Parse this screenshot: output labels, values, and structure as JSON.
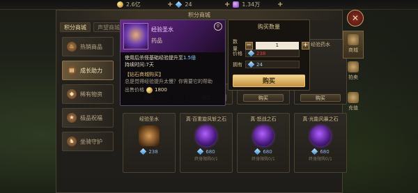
{
  "topbar": {
    "gold": "2.6亿",
    "diamonds": "24",
    "gems": "1.34万"
  },
  "panel": {
    "title": "积分商城",
    "tabs": [
      {
        "label": "积分商城",
        "active": true
      },
      {
        "label": "声望商城",
        "active": false
      }
    ]
  },
  "side_menu": [
    {
      "label": "热销商品",
      "icon": "fire-icon",
      "active": false
    },
    {
      "label": "成长助力",
      "icon": "book-icon",
      "active": true
    },
    {
      "label": "稀有物资",
      "icon": "gem-icon",
      "active": false
    },
    {
      "label": "极品祝福",
      "icon": "star-icon",
      "active": false
    },
    {
      "label": "坐骑守护",
      "icon": "mount-icon",
      "active": false
    }
  ],
  "tooltip": {
    "name": "经验圣水",
    "type": "药品",
    "effect_prefix": "使用后杀怪基础经验提升至",
    "effect_value": "1.5倍",
    "duration_prefix": "持续时间:",
    "duration_value": "7天",
    "section": "【钻石商城购买】",
    "desc": "总是觉得经验提升太慢？你需要它的帮助",
    "sell_label": "出售价格",
    "sell_price": "1800"
  },
  "buy": {
    "title": "购买数量",
    "qty_label": "数量",
    "qty_value": "1",
    "price_label": "价格",
    "price_value": "238",
    "owned_label": "拥有",
    "owned_value": "24",
    "buy_label": "购买"
  },
  "cards_top": [
    {
      "name": "",
      "buy": "购买"
    },
    {
      "name": "",
      "buy": "购买"
    },
    {
      "name": "",
      "buy": "购买"
    },
    {
      "name": "",
      "buy": "购买"
    }
  ],
  "cards_bottom": [
    {
      "name": "经验圣水",
      "price": "238",
      "limit": ""
    },
    {
      "name": "真·百重旋风斩之石",
      "price": "680",
      "limit": "终身限购0/1"
    },
    {
      "name": "真·怒战之石",
      "price": "680",
      "limit": "终身限购0/1"
    },
    {
      "name": "真·光能风暴之石",
      "price": "680",
      "limit": "终身限购0/1"
    }
  ],
  "card_top_right_name": "经验药水",
  "right_nav": [
    {
      "label": "商城",
      "active": true
    },
    {
      "label": "拍卖",
      "active": false
    },
    {
      "label": "充值",
      "active": false
    }
  ],
  "close_glyph": "✕"
}
